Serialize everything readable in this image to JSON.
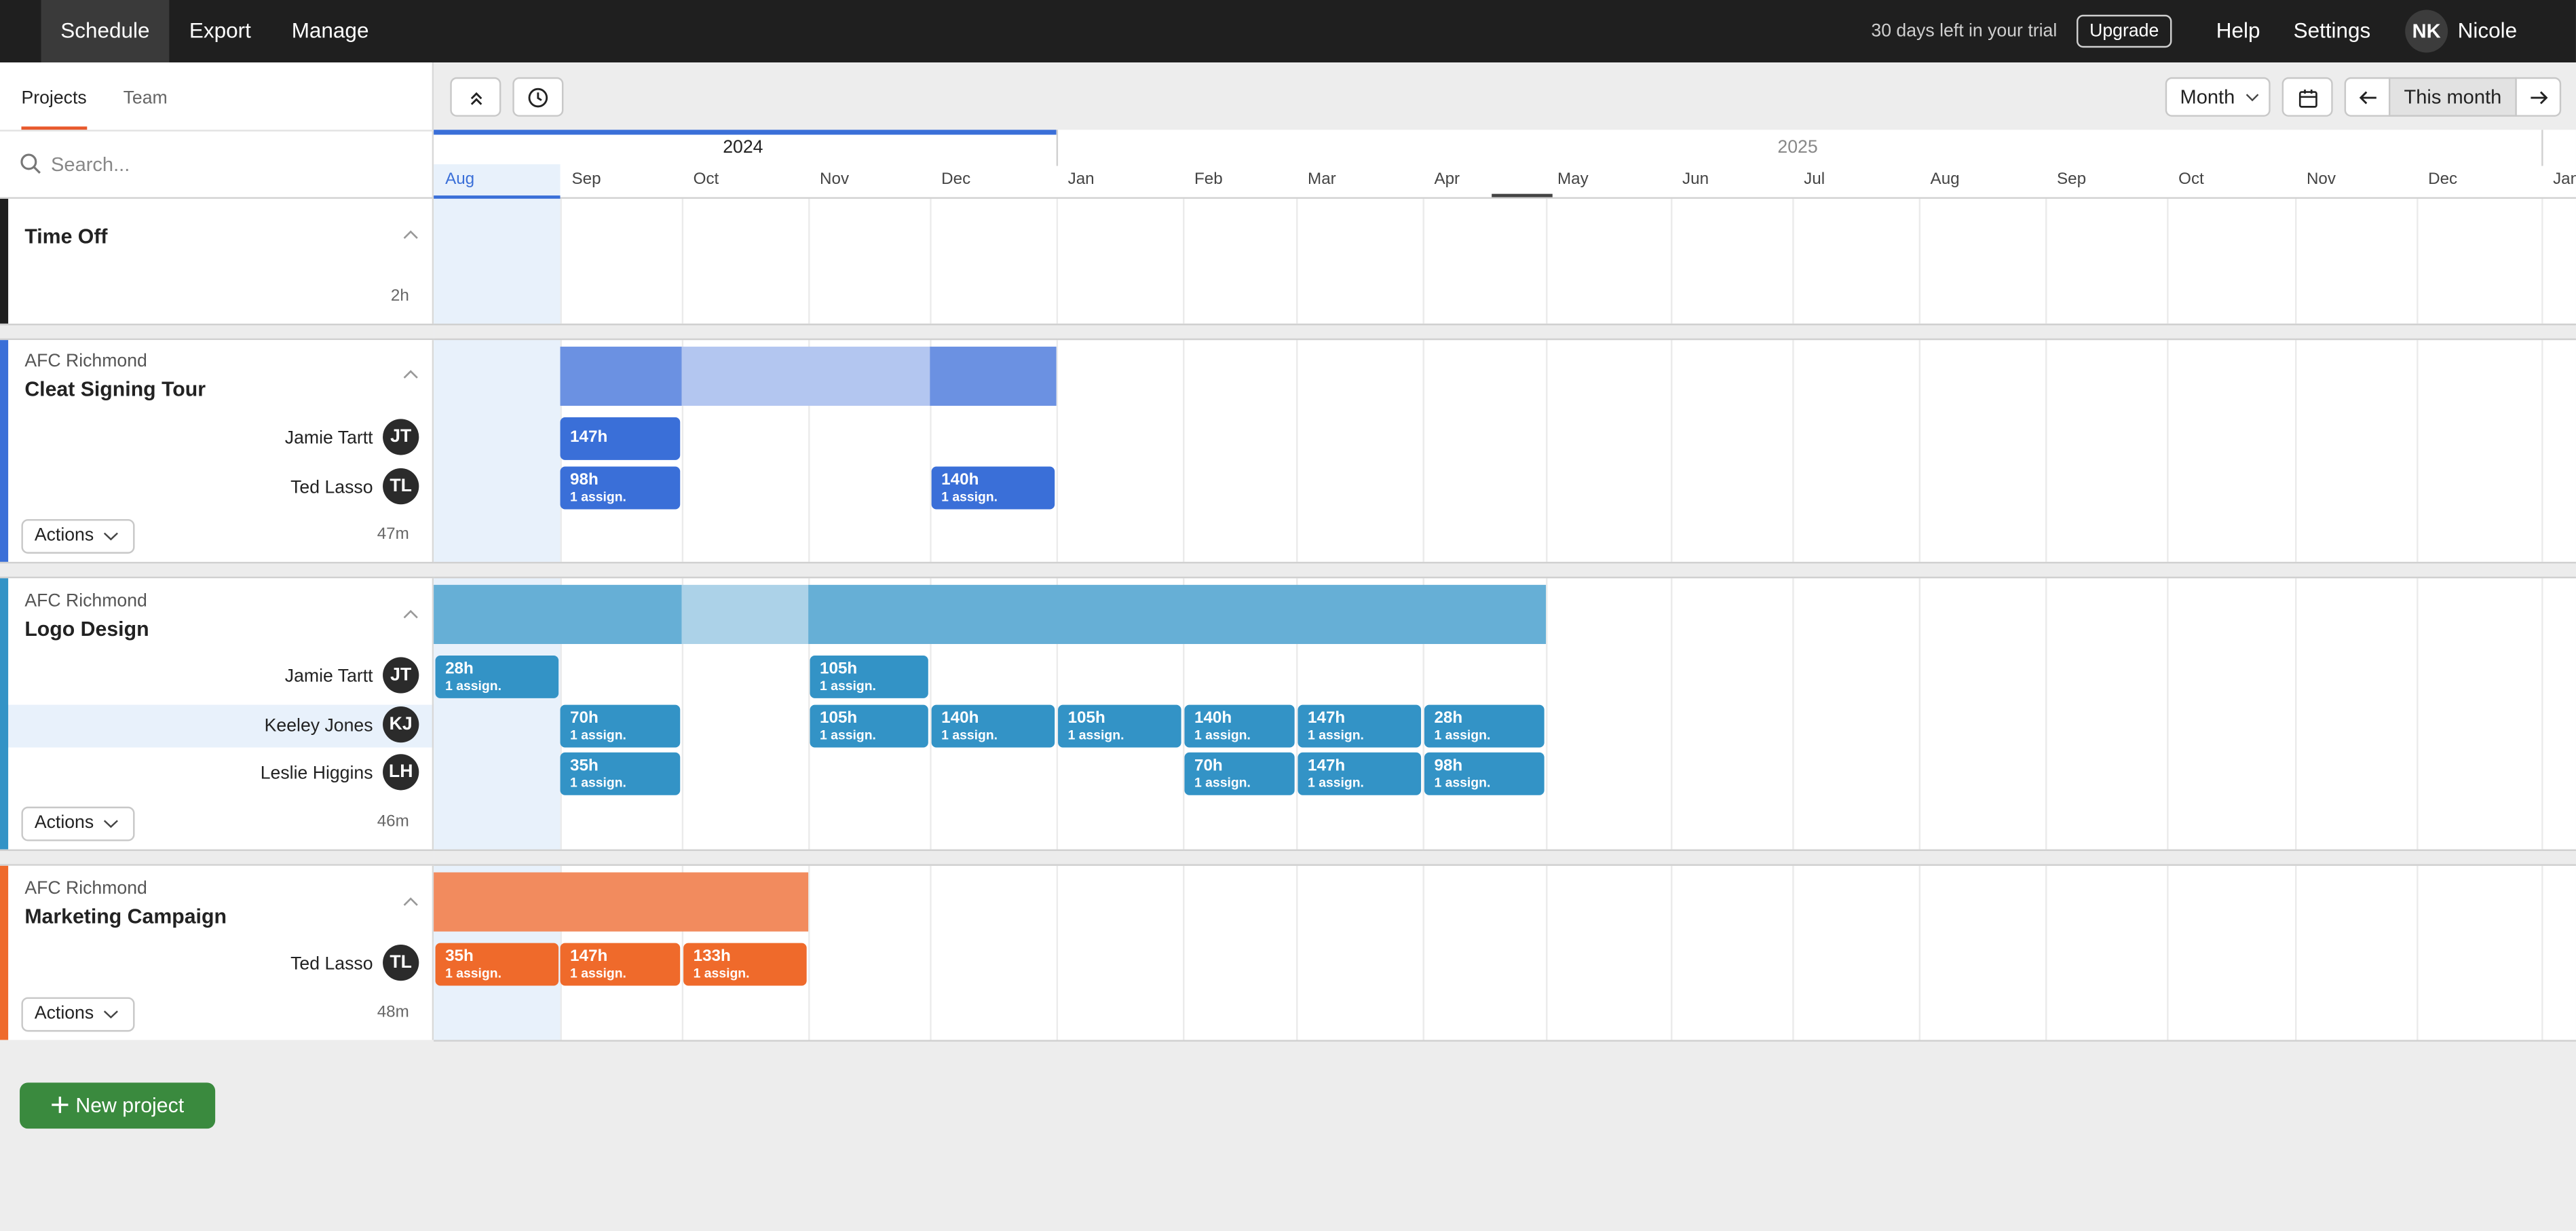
{
  "nav": {
    "tabs": [
      "Schedule",
      "Export",
      "Manage"
    ],
    "trial_text": "30 days left in your trial",
    "upgrade": "Upgrade",
    "help": "Help",
    "settings": "Settings",
    "user_initials": "NK",
    "user_name": "Nicole"
  },
  "left": {
    "tabs": [
      "Projects",
      "Team"
    ],
    "search_placeholder": "Search..."
  },
  "toolbar": {
    "view": "Month",
    "this_month": "This month"
  },
  "timeline": {
    "years": [
      "2024",
      "2025"
    ],
    "months": [
      "Aug",
      "Sep",
      "Oct",
      "Nov",
      "Dec",
      "Jan",
      "Feb",
      "Mar",
      "Apr",
      "May",
      "Jun",
      "Jul",
      "Aug",
      "Sep",
      "Oct",
      "Nov",
      "Dec",
      "Jan"
    ]
  },
  "sections": {
    "time_off": {
      "title": "Time Off",
      "duration": "2h"
    },
    "cleat": {
      "client": "AFC Richmond",
      "title": "Cleat Signing Tour",
      "actions": "Actions",
      "duration": "47m",
      "people": [
        {
          "name": "Jamie Tartt",
          "initials": "JT"
        },
        {
          "name": "Ted Lasso",
          "initials": "TL"
        }
      ],
      "blocks": {
        "jt_sep": "147h",
        "tl_sep": "98h",
        "tl_sep_sub": "1 assign.",
        "tl_dec": "140h",
        "tl_dec_sub": "1 assign."
      }
    },
    "logo": {
      "client": "AFC Richmond",
      "title": "Logo Design",
      "actions": "Actions",
      "duration": "46m",
      "people": [
        {
          "name": "Jamie Tartt",
          "initials": "JT"
        },
        {
          "name": "Keeley Jones",
          "initials": "KJ"
        },
        {
          "name": "Leslie Higgins",
          "initials": "LH"
        }
      ],
      "sub": "1 assign.",
      "jt": [
        "28h",
        "105h"
      ],
      "kj": [
        "70h",
        "105h",
        "140h",
        "105h",
        "140h",
        "147h",
        "28h"
      ],
      "lh": [
        "35h",
        "70h",
        "147h",
        "98h"
      ]
    },
    "marketing": {
      "client": "AFC Richmond",
      "title": "Marketing Campaign",
      "actions": "Actions",
      "duration": "48m",
      "people": [
        {
          "name": "Ted Lasso",
          "initials": "TL"
        }
      ],
      "sub": "1 assign.",
      "tl": [
        "35h",
        "147h",
        "133h"
      ]
    }
  },
  "new_project": "New project",
  "colors": {
    "cleat": "#3a6fd8",
    "logo": "#3393c6",
    "marketing": "#ef6a2b",
    "time_off": "#1f1f1f",
    "accent_tab": "#e8592c",
    "new_project": "#3a8a3e"
  }
}
